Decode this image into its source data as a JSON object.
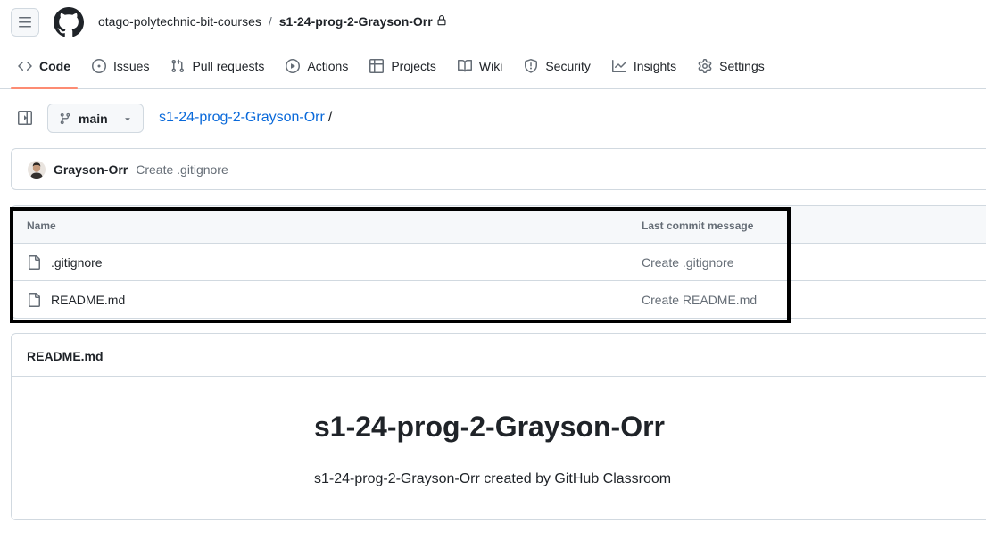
{
  "header": {
    "owner": "otago-polytechnic-bit-courses",
    "separator": "/",
    "repo": "s1-24-prog-2-Grayson-Orr"
  },
  "tabs": [
    {
      "label": "Code",
      "icon": "code-icon"
    },
    {
      "label": "Issues",
      "icon": "issue-icon"
    },
    {
      "label": "Pull requests",
      "icon": "pull-request-icon"
    },
    {
      "label": "Actions",
      "icon": "play-icon"
    },
    {
      "label": "Projects",
      "icon": "table-icon"
    },
    {
      "label": "Wiki",
      "icon": "book-icon"
    },
    {
      "label": "Security",
      "icon": "shield-icon"
    },
    {
      "label": "Insights",
      "icon": "graph-icon"
    },
    {
      "label": "Settings",
      "icon": "gear-icon"
    }
  ],
  "repo_bar": {
    "branch": "main",
    "path": "s1-24-prog-2-Grayson-Orr",
    "path_sep": "/"
  },
  "commit": {
    "author": "Grayson-Orr",
    "message": "Create .gitignore"
  },
  "files": {
    "headers": {
      "name": "Name",
      "message": "Last commit message"
    },
    "rows": [
      {
        "name": ".gitignore",
        "message": "Create .gitignore"
      },
      {
        "name": "README.md",
        "message": "Create README.md"
      }
    ]
  },
  "readme": {
    "title": "README.md",
    "heading": "s1-24-prog-2-Grayson-Orr",
    "body": "s1-24-prog-2-Grayson-Orr created by GitHub Classroom"
  },
  "colors": {
    "link": "#0969da",
    "active_tab_underline": "#fd8c73",
    "border": "#d1d9e0",
    "highlight_box": "#000000"
  }
}
